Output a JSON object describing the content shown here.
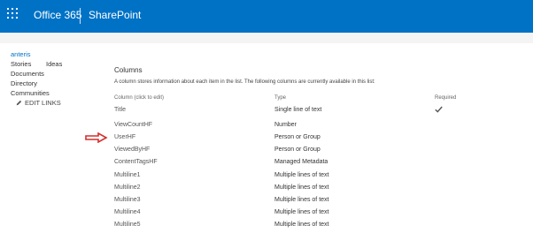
{
  "suite_bar": {
    "brand": "Office 365",
    "app": "SharePoint",
    "color": "#0072c6",
    "icon": "app-launcher-icon"
  },
  "left_nav": {
    "items": [
      {
        "label": "anteris",
        "current": true
      },
      {
        "label": "Stories"
      },
      {
        "label": "Ideas"
      },
      {
        "label": "Documents"
      },
      {
        "label": "Directory"
      },
      {
        "label": "Communities"
      }
    ],
    "edit_links": "EDIT LINKS",
    "edit_icon": "pencil-icon"
  },
  "columns_section": {
    "title": "Columns",
    "description": "A column stores information about each item in the list. The following columns are currently available in this list:",
    "headers": {
      "name": "Column (click to edit)",
      "type": "Type",
      "required": "Required"
    },
    "rows": [
      {
        "name": "Title",
        "type": "Single line of text",
        "required": true
      },
      {
        "name": "ViewCountHF",
        "type": "Number",
        "required": false
      },
      {
        "name": "UserHF",
        "type": "Person or Group",
        "required": false,
        "highlighted": true
      },
      {
        "name": "ViewedByHF",
        "type": "Person or Group",
        "required": false
      },
      {
        "name": "ContentTagsHF",
        "type": "Managed Metadata",
        "required": false
      },
      {
        "name": "Multiline1",
        "type": "Multiple lines of text",
        "required": false
      },
      {
        "name": "Multiline2",
        "type": "Multiple lines of text",
        "required": false
      },
      {
        "name": "Multiline3",
        "type": "Multiple lines of text",
        "required": false
      },
      {
        "name": "Multiline4",
        "type": "Multiple lines of text",
        "required": false
      },
      {
        "name": "Multiline5",
        "type": "Multiple lines of text",
        "required": false
      }
    ],
    "required_icon": "checkmark-icon",
    "annotation": {
      "icon": "red-arrow-icon",
      "color": "#d32f2f"
    }
  }
}
